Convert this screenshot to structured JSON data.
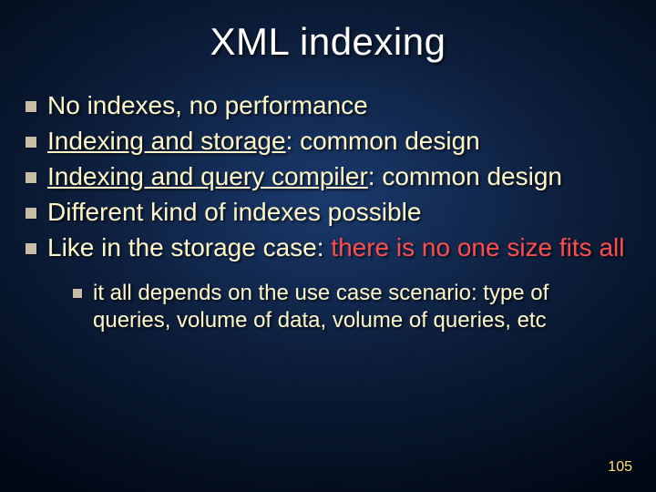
{
  "title": "XML indexing",
  "bullets": {
    "b1": "No indexes, no performance",
    "b2a": "Indexing and storage",
    "b2b": ": common design",
    "b3a": "Indexing and query compiler",
    "b3b": ": common design",
    "b4": "Different kind of indexes possible",
    "b5a": "Like in the storage case: ",
    "b5b": "there is no one size fits all"
  },
  "sub": {
    "s1": "it all depends on the use case scenario: type of queries, volume of data, volume of queries, etc"
  },
  "page_number": "105"
}
